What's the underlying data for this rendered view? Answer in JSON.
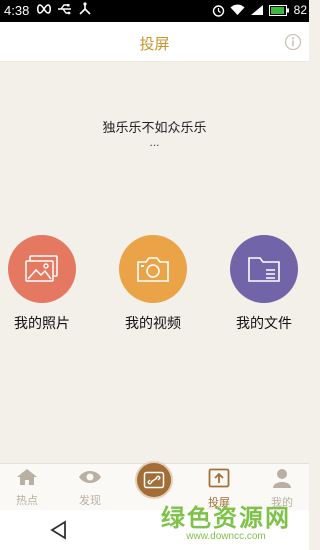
{
  "status_bar": {
    "time": "4:38",
    "battery": "82"
  },
  "header": {
    "title": "投屏"
  },
  "main": {
    "slogan": "独乐乐不如众乐乐",
    "ellipsis": "...",
    "tiles": [
      {
        "label": "我的照片",
        "color": "#e47860",
        "icon": "photo-icon"
      },
      {
        "label": "我的视频",
        "color": "#eba348",
        "icon": "camera-icon"
      },
      {
        "label": "我的文件",
        "color": "#7164a8",
        "icon": "folder-icon"
      }
    ]
  },
  "tabs": [
    {
      "label": "热点",
      "icon": "home-icon"
    },
    {
      "label": "发现",
      "icon": "eye-icon"
    },
    {
      "label": "投屏",
      "icon": "cast-icon",
      "active": true
    },
    {
      "label": "我的",
      "icon": "person-icon"
    }
  ],
  "watermark": {
    "brand": "绿色资源网",
    "url": "www.downcc.com"
  },
  "colors": {
    "accent": "#c8962a",
    "tab_active": "#a4703a",
    "background": "#f3efe9"
  }
}
